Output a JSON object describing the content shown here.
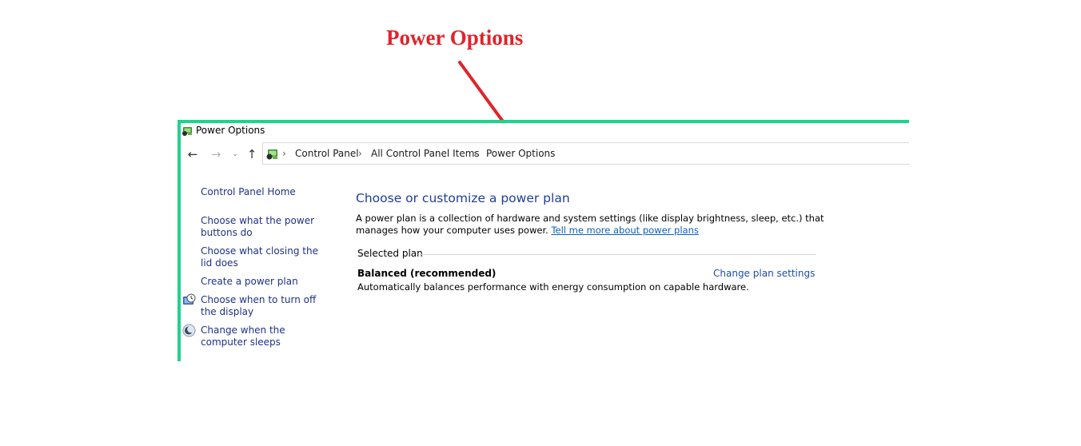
{
  "annotation": {
    "title": "Power Options",
    "color": "#e0232a"
  },
  "window": {
    "title": "Power Options",
    "frame_color": "#1fd38c",
    "title_icon": "power-options-icon"
  },
  "nav": {
    "back_glyph": "←",
    "forward_glyph": "→",
    "recent_glyph": "⌄",
    "up_glyph": "↑",
    "address_icon": "control-panel-icon",
    "separator": "›",
    "breadcrumb": [
      "Control Panel",
      "All Control Panel Items",
      "Power Options"
    ]
  },
  "sidebar": {
    "items": [
      {
        "label": "Control Panel Home"
      },
      {
        "label": "Choose what the power buttons do"
      },
      {
        "label": "Choose what closing the lid does"
      },
      {
        "label": "Create a power plan"
      },
      {
        "label": "Choose when to turn off the display",
        "icon": "display-clock-icon"
      },
      {
        "label": "Change when the computer sleeps",
        "icon": "moon-icon"
      }
    ]
  },
  "main": {
    "heading": "Choose or customize a power plan",
    "description": "A power plan is a collection of hardware and system settings (like display brightness, sleep, etc.) that manages how your computer uses power.",
    "learn_more_link": "Tell me more about power plans",
    "group_label": "Selected plan",
    "plan": {
      "name": "Balanced (recommended)",
      "description": "Automatically balances performance with energy consumption on capable hardware.",
      "settings_link": "Change plan settings"
    }
  }
}
